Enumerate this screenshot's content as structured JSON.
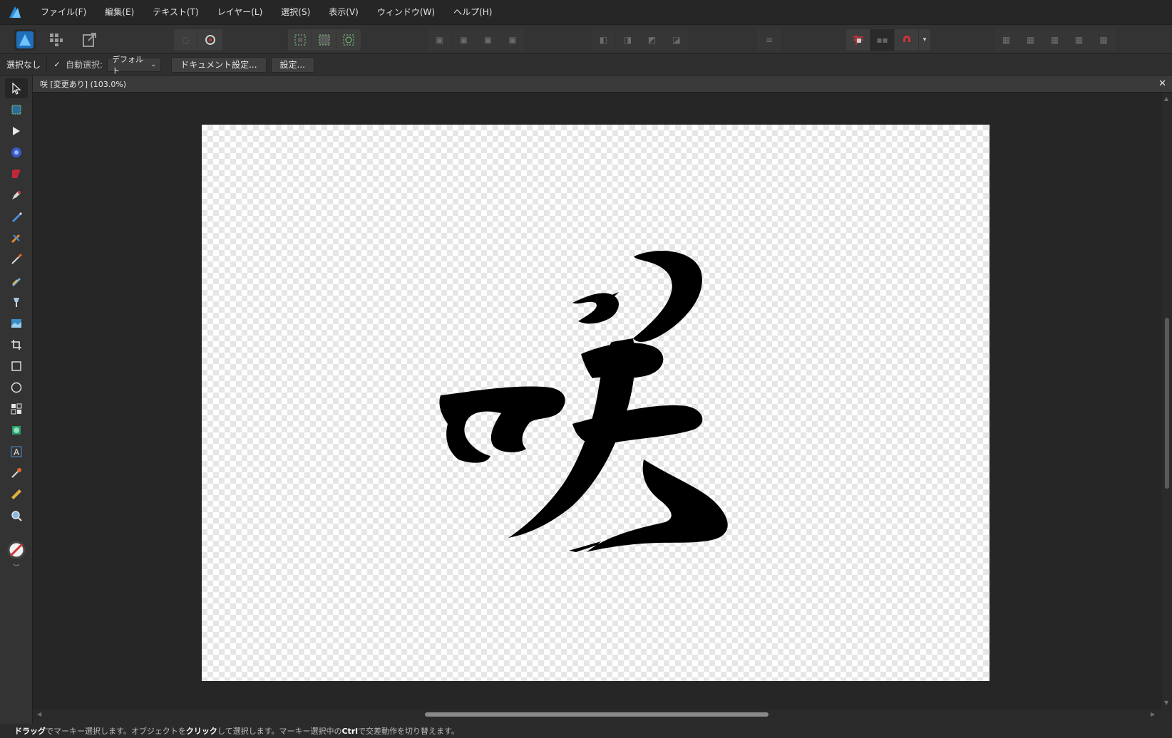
{
  "menu": {
    "items": [
      "ファイル(F)",
      "編集(E)",
      "テキスト(T)",
      "レイヤー(L)",
      "選択(S)",
      "表示(V)",
      "ウィンドウ(W)",
      "ヘルプ(H)"
    ]
  },
  "context": {
    "selection_label": "選択なし",
    "auto_select_label": "自動選択:",
    "auto_select_checked": true,
    "auto_select_value": "デフォルト",
    "document_setup_button": "ドキュメント設定...",
    "settings_button": "設定..."
  },
  "document": {
    "tab_title": "咲 [変更あり] (103.0%)",
    "close_glyph": "✕"
  },
  "status": {
    "hint_drag": "ドラッグ",
    "hint_part1": "でマーキー選択します。オブジェクトを",
    "hint_click": "クリック",
    "hint_part2": "して選択します。マーキー選択中の",
    "hint_ctrl": "Ctrl",
    "hint_part3": "で交差動作を切り替えます。"
  },
  "icons": {
    "app": "affinity-designer-logo",
    "tools": [
      "move-tool-icon",
      "artboard-tool-icon",
      "node-tool-icon",
      "corner-tool-icon",
      "point-transform-icon",
      "pen-tool-icon",
      "pencil-tool-icon",
      "vector-brush-icon",
      "fill-tool-icon",
      "transparency-tool-icon",
      "place-image-icon",
      "crop-tool-icon",
      "rectangle-tool-icon",
      "ellipse-tool-icon",
      "shapes-tool-icon",
      "text-frame-icon",
      "artistic-text-icon",
      "color-picker-icon",
      "measure-tool-icon",
      "zoom-tool-icon"
    ]
  },
  "colors": {
    "accent": "#2e8bd6",
    "snap_red": "#d0323a"
  }
}
